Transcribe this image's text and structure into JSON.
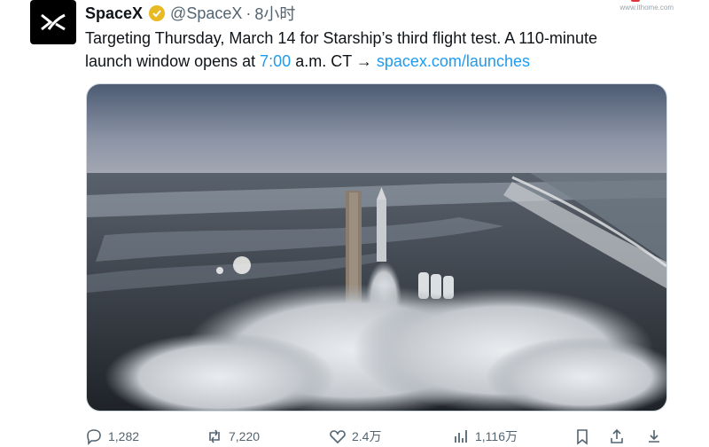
{
  "account": {
    "name": "SpaceX",
    "handle": "@SpaceX",
    "separator": "·",
    "time": "8小时",
    "verified_icon": "verified-badge-icon"
  },
  "tweet": {
    "line1": "Targeting Thursday, March 14 for Starship’s third flight test. A 110-minute",
    "line2_before": "launch window opens at ",
    "line2_time": "7:00",
    "line2_mid": " a.m. CT → ",
    "line2_link": "spacex.com/launches"
  },
  "media": {
    "description_icon": "rocket-launch-photo"
  },
  "actions": {
    "replies": "1,282",
    "retweets": "7,220",
    "likes": "2.4万",
    "views": "1,116万"
  },
  "watermark": {
    "text": "www.ithome.com"
  },
  "colors": {
    "link": "#1d9bf0",
    "text": "#0f1419",
    "muted": "#536471",
    "verified": "#e8b923"
  }
}
